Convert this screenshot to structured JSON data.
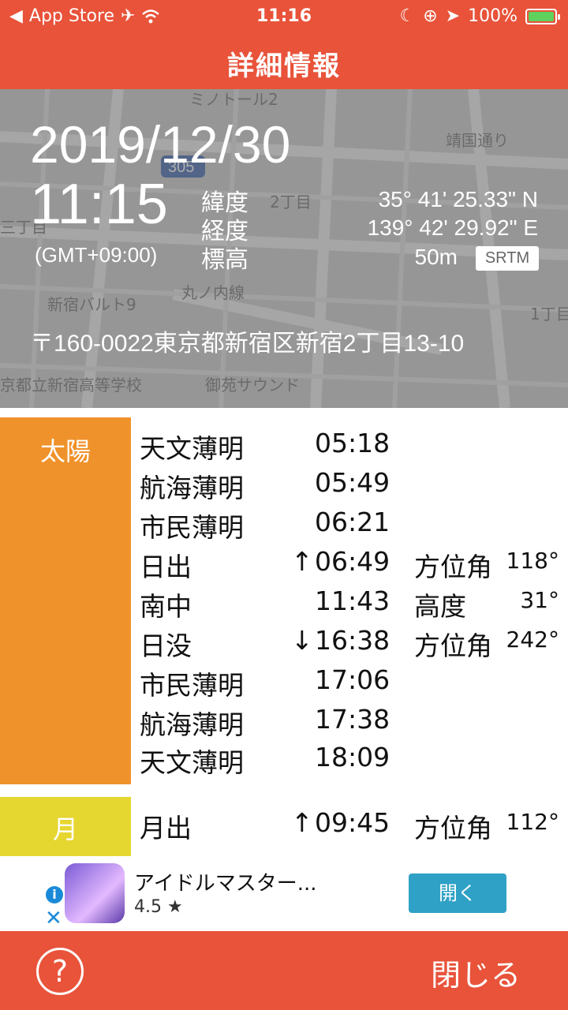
{
  "status_bar": {
    "back_app": "App Store",
    "time": "11:16",
    "battery": "100%",
    "icons": [
      "back-arrow-icon",
      "airplane-icon",
      "wifi-icon",
      "moon-icon",
      "rotation-lock-icon",
      "location-icon",
      "battery-icon"
    ]
  },
  "nav": {
    "title": "詳細情報"
  },
  "header": {
    "date": "2019/12/30",
    "time": "11:15",
    "gmt": "(GMT+09:00)",
    "latitude_label": "緯度",
    "latitude_value": "35° 41' 25.33\" N",
    "longitude_label": "経度",
    "longitude_value": "139° 42' 29.92\" E",
    "elevation_label": "標高",
    "elevation_value": "50m",
    "elevation_source": "SRTM",
    "address": "〒160-0022東京都新宿区新宿2丁目13-10"
  },
  "map_labels": [
    "ミノトール2",
    "靖国通り",
    "305",
    "2丁目",
    "三丁目",
    "新宿バルト9",
    "丸ノ内線",
    "1丁目",
    "京都立新宿高等学校",
    "御苑サウンド"
  ],
  "sun": {
    "label": "太陽",
    "rows": [
      {
        "name": "天文薄明",
        "arrow": "",
        "time": "05:18",
        "sub": "",
        "deg": ""
      },
      {
        "name": "航海薄明",
        "arrow": "",
        "time": "05:49",
        "sub": "",
        "deg": ""
      },
      {
        "name": "市民薄明",
        "arrow": "",
        "time": "06:21",
        "sub": "",
        "deg": ""
      },
      {
        "name": "日出",
        "arrow": "↑",
        "time": "06:49",
        "sub": "方位角",
        "deg": "118°"
      },
      {
        "name": "南中",
        "arrow": "",
        "time": "11:43",
        "sub": "高度",
        "deg": "31°"
      },
      {
        "name": "日没",
        "arrow": "↓",
        "time": "16:38",
        "sub": "方位角",
        "deg": "242°"
      },
      {
        "name": "市民薄明",
        "arrow": "",
        "time": "17:06",
        "sub": "",
        "deg": ""
      },
      {
        "name": "航海薄明",
        "arrow": "",
        "time": "17:38",
        "sub": "",
        "deg": ""
      },
      {
        "name": "天文薄明",
        "arrow": "",
        "time": "18:09",
        "sub": "",
        "deg": ""
      }
    ]
  },
  "moon": {
    "label": "月",
    "rows": [
      {
        "name": "月出",
        "arrow": "↑",
        "time": "09:45",
        "sub": "方位角",
        "deg": "112°"
      }
    ]
  },
  "ad": {
    "title": "アイドルマスター...",
    "rating": "4.5 ★",
    "open_label": "開く"
  },
  "bottom": {
    "help_label": "?",
    "close_label": "閉じる"
  },
  "colors": {
    "bar": "#e8533a",
    "sun": "#f0922b",
    "moon": "#e6d630",
    "ad_button": "#2fa1c6"
  }
}
